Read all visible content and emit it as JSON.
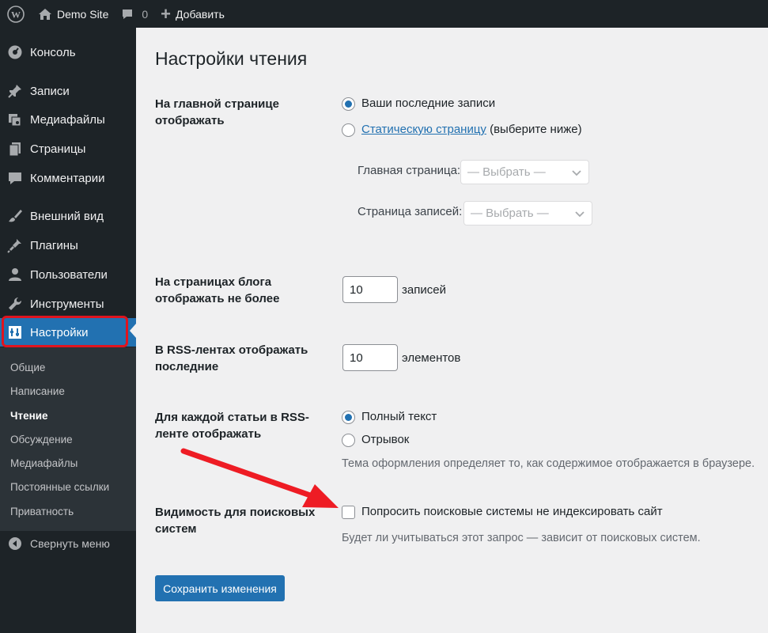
{
  "admin_bar": {
    "site_name": "Demo Site",
    "comments_count": "0",
    "new_label": "Добавить"
  },
  "sidebar": {
    "items": [
      {
        "label": "Консоль",
        "icon": "dashboard-icon"
      },
      {
        "label": "Записи",
        "icon": "pin-icon"
      },
      {
        "label": "Медиафайлы",
        "icon": "media-icon"
      },
      {
        "label": "Страницы",
        "icon": "pages-icon"
      },
      {
        "label": "Комментарии",
        "icon": "comment-icon"
      },
      {
        "label": "Внешний вид",
        "icon": "brush-icon"
      },
      {
        "label": "Плагины",
        "icon": "plugin-icon"
      },
      {
        "label": "Пользователи",
        "icon": "users-icon"
      },
      {
        "label": "Инструменты",
        "icon": "wrench-icon"
      },
      {
        "label": "Настройки",
        "icon": "settings-icon"
      }
    ],
    "submenu": [
      "Общие",
      "Написание",
      "Чтение",
      "Обсуждение",
      "Медиафайлы",
      "Постоянные ссылки",
      "Приватность"
    ],
    "collapse_label": "Свернуть меню"
  },
  "page": {
    "title": "Настройки чтения",
    "front_page": {
      "label_line1": "На главной странице",
      "label_line2": "отображать",
      "option_latest": "Ваши последние записи",
      "option_static_link": "Статическую страницу",
      "option_static_suffix": "(выберите ниже)",
      "homepage_label": "Главная страница:",
      "homepage_select": "— Выбрать —",
      "posts_page_label": "Страница записей:",
      "posts_page_select": "— Выбрать —"
    },
    "blog_pages": {
      "label_line1": "На страницах блога",
      "label_line2": "отображать не более",
      "value": "10",
      "unit": "записей"
    },
    "rss": {
      "label_line1": "В RSS-лентах отображать",
      "label_line2": "последние",
      "value": "10",
      "unit": "элементов"
    },
    "feed_content": {
      "label_line1": "Для каждой статьи в RSS-",
      "label_line2": "ленте отображать",
      "option_full": "Полный текст",
      "option_excerpt": "Отрывок",
      "description": "Тема оформления определяет то, как содержимое отображается в браузере."
    },
    "search_visibility": {
      "label_line1": "Видимость для поисковых",
      "label_line2": "систем",
      "checkbox_label": "Попросить поисковые системы не индексировать сайт",
      "description": "Будет ли учитываться этот запрос — зависит от поисковых систем."
    },
    "save_button": "Сохранить изменения"
  },
  "colors": {
    "accent": "#2271b1",
    "highlight_outline": "#e0141e",
    "annotation_arrow": "#ee1c24"
  }
}
